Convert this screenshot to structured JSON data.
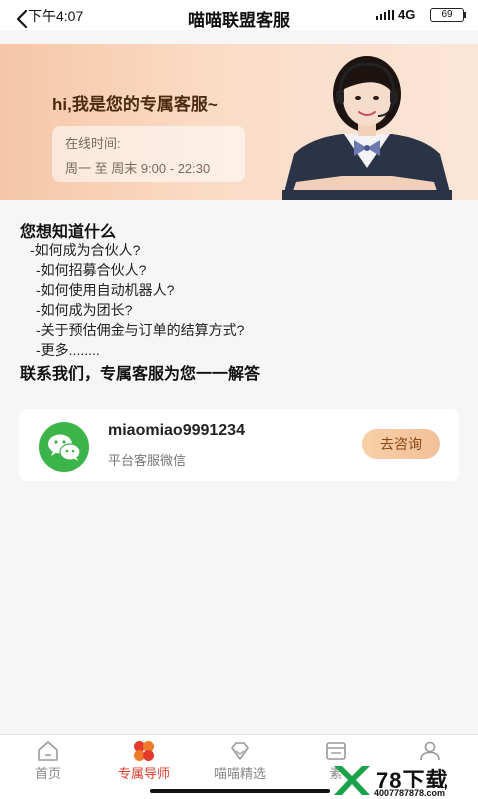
{
  "status_bar": {
    "time": "下午4:07",
    "network": "4G",
    "battery": "69"
  },
  "header": {
    "title": "喵喵联盟客服"
  },
  "banner": {
    "headline": "hi,我是您的专属客服~",
    "hours_label": "在线时间:",
    "hours_value": "周一 至 周末 9:00 - 22:30"
  },
  "faq": {
    "heading": "您想知道什么",
    "items": [
      "-如何成为合伙人?",
      "-如何招募合伙人?",
      "-如何使用自动机器人?",
      "-如何成为团长?",
      "-关于预估佣金与订单的结算方式?",
      "-更多........"
    ],
    "footer": "联系我们，专属客服为您一一解答"
  },
  "contact": {
    "id": "miaomiao9991234",
    "description": "平台客服微信",
    "button_label": "去咨询",
    "icon": "wechat-icon"
  },
  "tabs": [
    {
      "label": "首页",
      "icon": "home-icon",
      "active": false
    },
    {
      "label": "专属导师",
      "icon": "mentor-icon",
      "active": true
    },
    {
      "label": "喵喵精选",
      "icon": "diamond-icon",
      "active": false
    },
    {
      "label": "素",
      "icon": "card-icon",
      "active": false
    },
    {
      "label": "",
      "icon": "profile-icon",
      "active": false
    }
  ],
  "watermark": {
    "title": "78下载",
    "url": "4007787878.com"
  },
  "colors": {
    "accent": "#e23b2b",
    "banner_start": "#f6c6a8",
    "banner_end": "#fbe6d8",
    "wechat_green": "#3bb54a",
    "button_bg": "#f8cfa6"
  }
}
